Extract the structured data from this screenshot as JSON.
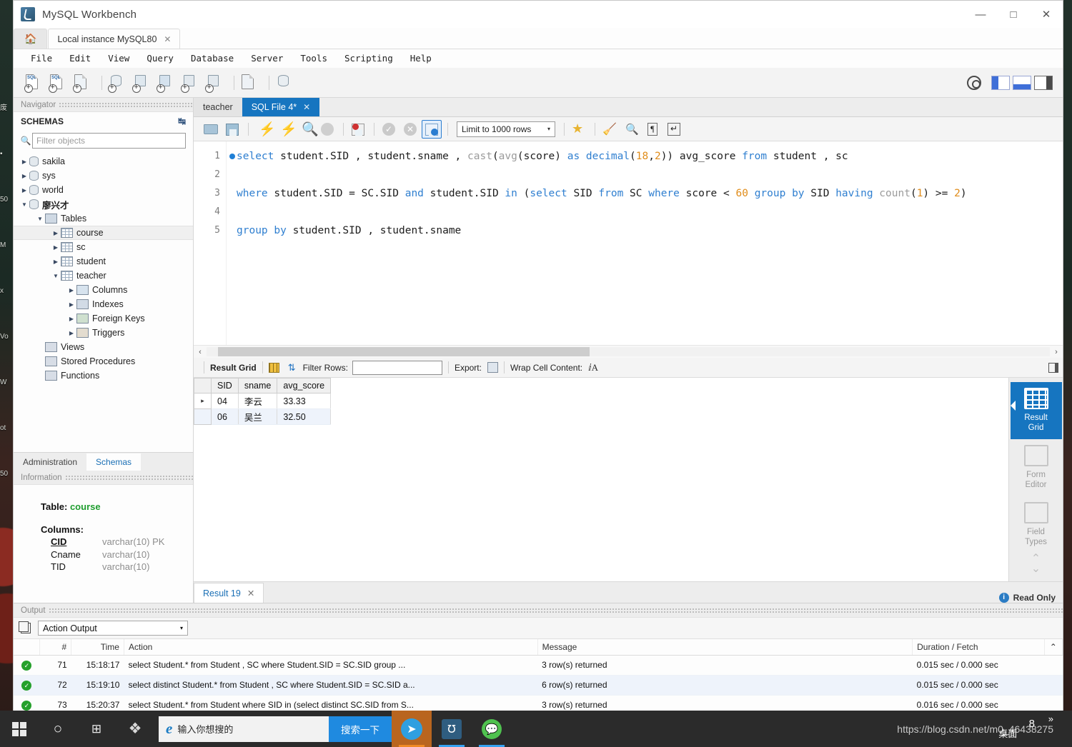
{
  "window": {
    "title": "MySQL Workbench",
    "logo_icon": "mysql-dolphin-icon",
    "minimize": "—",
    "maximize": "□",
    "close": "✕"
  },
  "tabstrip": {
    "home_icon": "home-icon",
    "tabs": [
      {
        "label": "Local instance MySQL80",
        "close": "✕",
        "active": true
      }
    ]
  },
  "menubar": {
    "items": [
      "File",
      "Edit",
      "View",
      "Query",
      "Database",
      "Server",
      "Tools",
      "Scripting",
      "Help"
    ]
  },
  "main_toolbar": {
    "icons": [
      "new-sql-tab-icon",
      "open-sql-script-icon",
      "connection-info-icon",
      "new-schema-icon",
      "new-table-icon",
      "new-view-icon",
      "new-procedure-icon",
      "new-function-icon",
      "search-table-data-icon",
      "reconnect-server-icon"
    ],
    "right_icons": [
      "account-icon",
      "toggle-sidebar-icon",
      "toggle-output-icon",
      "toggle-secondary-sidebar-icon"
    ]
  },
  "navigator": {
    "panel_title": "Navigator",
    "section_title": "SCHEMAS",
    "refresh_icon": "refresh-icon",
    "search_icon": "search-icon",
    "filter_placeholder": "Filter objects",
    "filter_value": "",
    "tree": [
      {
        "label": "sakila",
        "depth": 0,
        "arrow": "▶",
        "icon": "schema-icon",
        "bold": false,
        "selected": false
      },
      {
        "label": "sys",
        "depth": 0,
        "arrow": "▶",
        "icon": "schema-icon",
        "bold": false,
        "selected": false
      },
      {
        "label": "world",
        "depth": 0,
        "arrow": "▶",
        "icon": "schema-icon",
        "bold": false,
        "selected": false
      },
      {
        "label": "廖兴才",
        "depth": 0,
        "arrow": "▼",
        "icon": "schema-icon",
        "bold": true,
        "selected": false
      },
      {
        "label": "Tables",
        "depth": 1,
        "arrow": "▼",
        "icon": "tables-folder-icon",
        "bold": false,
        "selected": false
      },
      {
        "label": "course",
        "depth": 2,
        "arrow": "▶",
        "icon": "table-icon",
        "bold": false,
        "selected": true
      },
      {
        "label": "sc",
        "depth": 2,
        "arrow": "▶",
        "icon": "table-icon",
        "bold": false,
        "selected": false
      },
      {
        "label": "student",
        "depth": 2,
        "arrow": "▶",
        "icon": "table-icon",
        "bold": false,
        "selected": false
      },
      {
        "label": "teacher",
        "depth": 2,
        "arrow": "▼",
        "icon": "table-icon",
        "bold": false,
        "selected": false
      },
      {
        "label": "Columns",
        "depth": 3,
        "arrow": "▶",
        "icon": "columns-icon",
        "bold": false,
        "selected": false
      },
      {
        "label": "Indexes",
        "depth": 3,
        "arrow": "▶",
        "icon": "indexes-icon",
        "bold": false,
        "selected": false
      },
      {
        "label": "Foreign Keys",
        "depth": 3,
        "arrow": "▶",
        "icon": "foreign-keys-icon",
        "bold": false,
        "selected": false
      },
      {
        "label": "Triggers",
        "depth": 3,
        "arrow": "▶",
        "icon": "triggers-icon",
        "bold": false,
        "selected": false
      },
      {
        "label": "Views",
        "depth": 1,
        "arrow": "",
        "icon": "views-icon",
        "bold": false,
        "selected": false
      },
      {
        "label": "Stored Procedures",
        "depth": 1,
        "arrow": "",
        "icon": "procedures-icon",
        "bold": false,
        "selected": false
      },
      {
        "label": "Functions",
        "depth": 1,
        "arrow": "",
        "icon": "functions-icon",
        "bold": false,
        "selected": false
      }
    ],
    "bottom_tabs": [
      {
        "label": "Administration",
        "active": false
      },
      {
        "label": "Schemas",
        "active": true
      }
    ]
  },
  "information": {
    "panel_title": "Information",
    "table_label": "Table:",
    "table_name": "course",
    "columns_label": "Columns:",
    "columns": [
      {
        "name": "CID",
        "type": "varchar(10) PK",
        "pk": true
      },
      {
        "name": "Cname",
        "type": "varchar(10)",
        "pk": false
      },
      {
        "name": "TID",
        "type": "varchar(10)",
        "pk": false
      }
    ]
  },
  "editor": {
    "tabs": [
      {
        "label": "teacher",
        "active": false,
        "close": ""
      },
      {
        "label": "SQL File 4*",
        "active": true,
        "close": "✕"
      }
    ],
    "toolbar": {
      "icons": [
        "open-script-icon",
        "save-script-icon",
        "execute-icon",
        "execute-current-statement-icon",
        "explain-icon",
        "stop-icon",
        "toggle-stop-on-error-icon",
        "commit-icon",
        "rollback-icon",
        "toggle-autocommit-icon"
      ],
      "limit_label": "Limit to 1000 rows",
      "limit_caret": "▾",
      "right_icons": [
        "snippet-icon",
        "beautify-icon",
        "find-icon",
        "show-invisible-icon",
        "wrap-lines-icon"
      ]
    },
    "lines": [
      {
        "num": "1",
        "marker": true
      },
      {
        "num": "2",
        "marker": false
      },
      {
        "num": "3",
        "marker": false
      },
      {
        "num": "4",
        "marker": false
      },
      {
        "num": "5",
        "marker": false
      }
    ],
    "code": {
      "line1": [
        {
          "t": "select ",
          "c": "k"
        },
        {
          "t": "student.SID , student.sname , ",
          "c": "id"
        },
        {
          "t": "cast",
          "c": "fn"
        },
        {
          "t": "(",
          "c": "op"
        },
        {
          "t": "avg",
          "c": "fn"
        },
        {
          "t": "(score) ",
          "c": "id"
        },
        {
          "t": "as ",
          "c": "k"
        },
        {
          "t": "decimal",
          "c": "k"
        },
        {
          "t": "(",
          "c": "op"
        },
        {
          "t": "18",
          "c": "n"
        },
        {
          "t": ",",
          "c": "op"
        },
        {
          "t": "2",
          "c": "n"
        },
        {
          "t": ")) avg_score ",
          "c": "id"
        },
        {
          "t": "from ",
          "c": "k"
        },
        {
          "t": "student , sc",
          "c": "id"
        }
      ],
      "line2": [],
      "line3": [
        {
          "t": "where ",
          "c": "k"
        },
        {
          "t": "student.SID = SC.SID ",
          "c": "id"
        },
        {
          "t": "and ",
          "c": "k"
        },
        {
          "t": "student.SID ",
          "c": "id"
        },
        {
          "t": "in ",
          "c": "k"
        },
        {
          "t": "(",
          "c": "op"
        },
        {
          "t": "select ",
          "c": "k"
        },
        {
          "t": "SID ",
          "c": "id"
        },
        {
          "t": "from ",
          "c": "k"
        },
        {
          "t": "SC ",
          "c": "id"
        },
        {
          "t": "where ",
          "c": "k"
        },
        {
          "t": "score ",
          "c": "id"
        },
        {
          "t": "< ",
          "c": "op"
        },
        {
          "t": "60 ",
          "c": "n"
        },
        {
          "t": "group by ",
          "c": "k"
        },
        {
          "t": "SID ",
          "c": "id"
        },
        {
          "t": "having ",
          "c": "k"
        },
        {
          "t": "count",
          "c": "fn"
        },
        {
          "t": "(",
          "c": "op"
        },
        {
          "t": "1",
          "c": "n"
        },
        {
          "t": ") >= ",
          "c": "op"
        },
        {
          "t": "2",
          "c": "n"
        },
        {
          "t": ")",
          "c": "op"
        }
      ],
      "line4": [],
      "line5": [
        {
          "t": "group by ",
          "c": "k"
        },
        {
          "t": "student.SID , student.sname",
          "c": "id"
        }
      ]
    },
    "hscroll": {
      "left_arrow": "‹",
      "right_arrow": "›"
    }
  },
  "result_toolbar": {
    "result_grid_label": "Result Grid",
    "grid_icon": "grid-view-icon",
    "refresh_icon": "refresh-grid-icon",
    "filter_rows_label": "Filter Rows:",
    "filter_rows_value": "",
    "export_label": "Export:",
    "export_icon": "export-recordset-icon",
    "wrap_label": "Wrap Cell Content:",
    "wrap_icon": "wrap-cell-icon",
    "split_icon": "toggle-panel-icon"
  },
  "result_grid": {
    "columns": [
      "SID",
      "sname",
      "avg_score"
    ],
    "rows": [
      {
        "marker": "▸",
        "SID": "04",
        "sname": "李云",
        "avg_score": "33.33"
      },
      {
        "marker": "",
        "SID": "06",
        "sname": "吴兰",
        "avg_score": "32.50"
      }
    ]
  },
  "rail": {
    "items": [
      {
        "label_top": "Result",
        "label_bottom": "Grid",
        "icon": "result-grid-icon",
        "active": true
      },
      {
        "label_top": "Form",
        "label_bottom": "Editor",
        "icon": "form-editor-icon",
        "active": false
      },
      {
        "label_top": "Field",
        "label_bottom": "Types",
        "icon": "field-types-icon",
        "active": false
      }
    ],
    "spinner_up": "⌃",
    "spinner_down": "⌄"
  },
  "result_footer": {
    "tabs": [
      {
        "label": "Result 19",
        "close": "✕"
      }
    ],
    "read_only": "Read Only",
    "info_icon": "info-icon"
  },
  "output": {
    "panel_title": "Output",
    "copy_icon": "copy-icon",
    "selected_view": "Action Output",
    "caret": "▾",
    "columns": [
      "#",
      "Time",
      "Action",
      "Message",
      "Duration / Fetch"
    ],
    "rows": [
      {
        "status": "success",
        "num": "71",
        "time": "15:18:17",
        "action": "select Student.* from Student , SC  where Student.SID = SC.SID  group ...",
        "message": "3 row(s) returned",
        "duration": "0.015 sec / 0.000 sec"
      },
      {
        "status": "success",
        "num": "72",
        "time": "15:19:10",
        "action": "select distinct Student.* from Student , SC where Student.SID = SC.SID a...",
        "message": "6 row(s) returned",
        "duration": "0.015 sec / 0.000 sec"
      },
      {
        "status": "success",
        "num": "73",
        "time": "15:20:37",
        "action": "select Student.* from Student where SID in  (select distinct SC.SID from S...",
        "message": "3 row(s) returned",
        "duration": "0.016 sec / 0.000 sec"
      }
    ],
    "scroll_up": "⌃"
  },
  "taskbar": {
    "start_icon": "windows-start-icon",
    "cortana_icon": "cortana-circle-icon",
    "taskview_icon": "task-view-icon",
    "app_icon": "pinwheel-icon",
    "search": {
      "browser_icon": "internet-explorer-icon",
      "placeholder": "输入你想搜的",
      "button_label": "搜索一下"
    },
    "apps": [
      {
        "icon": "telegram-bird-icon",
        "running": true,
        "highlight": true
      },
      {
        "icon": "mysql-workbench-icon",
        "running": true,
        "highlight": false
      },
      {
        "icon": "wechat-icon",
        "running": true,
        "highlight": false
      }
    ],
    "watermark": "https://blog.csdn.net/m0_46438275",
    "desktop_label": "桌面",
    "chevron": "»",
    "badge": "8"
  },
  "desktop": {
    "icon_labels": [
      "废",
      "▪",
      "50",
      "M",
      "x",
      "Vo",
      "W",
      "ot",
      "50"
    ]
  }
}
